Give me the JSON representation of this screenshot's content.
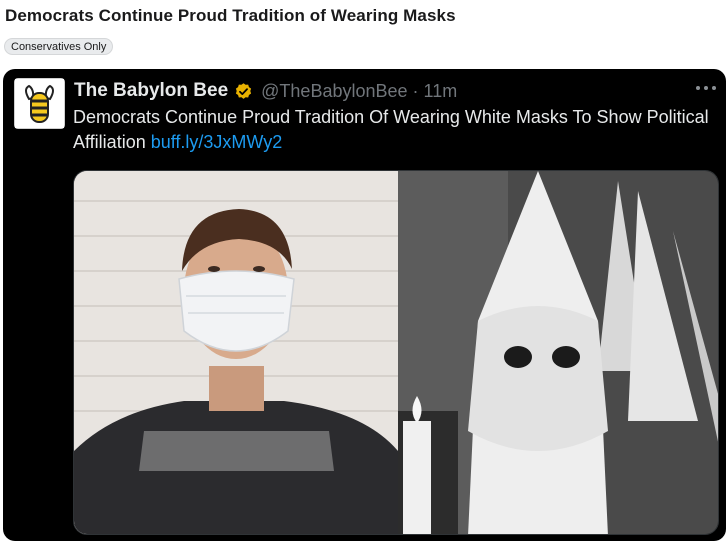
{
  "post": {
    "title": "Democrats Continue Proud Tradition of Wearing Masks",
    "flair": "Conservatives Only"
  },
  "tweet": {
    "display_name": "The Babylon Bee",
    "handle": "@TheBabylonBee",
    "separator": "·",
    "time": "11m",
    "text": "Democrats Continue Proud Tradition Of Wearing White Masks To Show Political Affiliation ",
    "link": "buff.ly/3JxMWy2",
    "link_color": "#1d9bf0",
    "verified_color": "#e8b100",
    "more_icon": "more-horizontal-icon",
    "avatar_icon": "bee-logo-icon"
  }
}
